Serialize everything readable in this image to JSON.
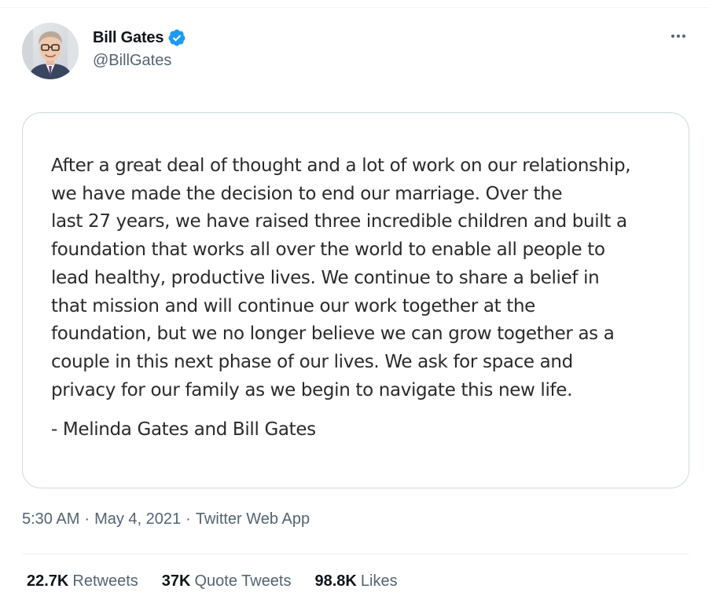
{
  "author": {
    "display_name": "Bill Gates",
    "handle": "@BillGates",
    "verified": true,
    "avatar": "avatar-photo"
  },
  "statement": {
    "lines": [
      "After a great deal of thought and a lot of work on our relationship,",
      "we have made the decision to end our marriage. Over the",
      "last 27 years, we have raised three incredible children and built a",
      "foundation that works all over the world to enable all people to",
      "lead healthy, productive lives. We continue to share a belief in",
      "that mission and will continue our work together at the",
      "foundation, but we no longer believe we can grow together as a",
      "couple in this next phase of our lives. We ask for space and",
      "privacy for our family as we begin to navigate this new life."
    ],
    "signature": "- Melinda Gates and Bill Gates"
  },
  "meta": {
    "time": "5:30 AM",
    "separator": "·",
    "date": "May 4, 2021",
    "source": "Twitter Web App"
  },
  "stats": {
    "retweets_count": "22.7K",
    "retweets_label": "Retweets",
    "quotes_count": "37K",
    "quotes_label": "Quote Tweets",
    "likes_count": "98.8K",
    "likes_label": "Likes"
  },
  "icons": {
    "more": "more-horizontal-icon",
    "verified": "verified-badge-icon"
  },
  "colors": {
    "verified_blue": "#1d9bf0",
    "secondary_text": "#536471",
    "primary_text": "#0f1419",
    "card_border": "#cfd9de"
  }
}
